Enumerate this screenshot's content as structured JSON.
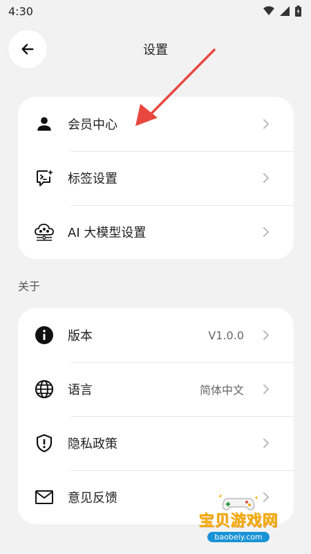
{
  "status_bar": {
    "time": "4:30"
  },
  "header": {
    "title": "设置"
  },
  "account_card": {
    "items": [
      {
        "label": "会员中心",
        "icon": "person-icon"
      },
      {
        "label": "标签设置",
        "icon": "tag-chat-icon"
      },
      {
        "label": "AI 大模型设置",
        "icon": "cloud-settings-icon"
      }
    ]
  },
  "about_section": {
    "label": "关于",
    "items": [
      {
        "label": "版本",
        "value": "V1.0.0",
        "icon": "info-icon"
      },
      {
        "label": "语言",
        "value": "简体中文",
        "icon": "globe-icon"
      },
      {
        "label": "隐私政策",
        "icon": "shield-alert-icon"
      },
      {
        "label": "意见反馈",
        "icon": "mail-icon"
      }
    ]
  },
  "watermark": {
    "title": "宝贝游戏网",
    "url": "baobeiy.com"
  },
  "colors": {
    "annotation_arrow": "#e8473f",
    "card_bg": "#ffffff",
    "page_bg": "#f2f2f2"
  }
}
